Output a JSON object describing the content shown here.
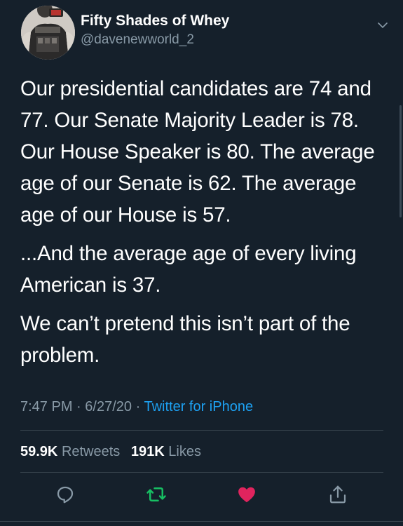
{
  "user": {
    "display_name": "Fifty Shades of Whey",
    "handle": "@davenewworld_2"
  },
  "tweet": {
    "paragraphs": [
      "Our presidential candidates are 74 and 77. Our Senate Majority Leader is 78. Our House Speaker is 80. The average age of our Senate is 62. The average age of our House is 57.",
      "...And the average age of every living American is 37.",
      "We can’t pretend this isn’t part of the problem."
    ],
    "time": "7:47 PM",
    "date": "6/27/20",
    "separator": "·",
    "source": "Twitter for iPhone"
  },
  "stats": {
    "retweets_count": "59.9K",
    "retweets_label": "Retweets",
    "likes_count": "191K",
    "likes_label": "Likes"
  },
  "actions": {
    "reply_icon": "reply-icon",
    "retweet_icon": "retweet-icon",
    "like_icon": "heart-icon",
    "share_icon": "share-icon"
  },
  "colors": {
    "background": "#15202b",
    "text": "#ffffff",
    "secondary": "#8899a6",
    "link": "#1da1f2",
    "retweet": "#17bf63",
    "like": "#e0245e",
    "divider": "#38444d"
  }
}
